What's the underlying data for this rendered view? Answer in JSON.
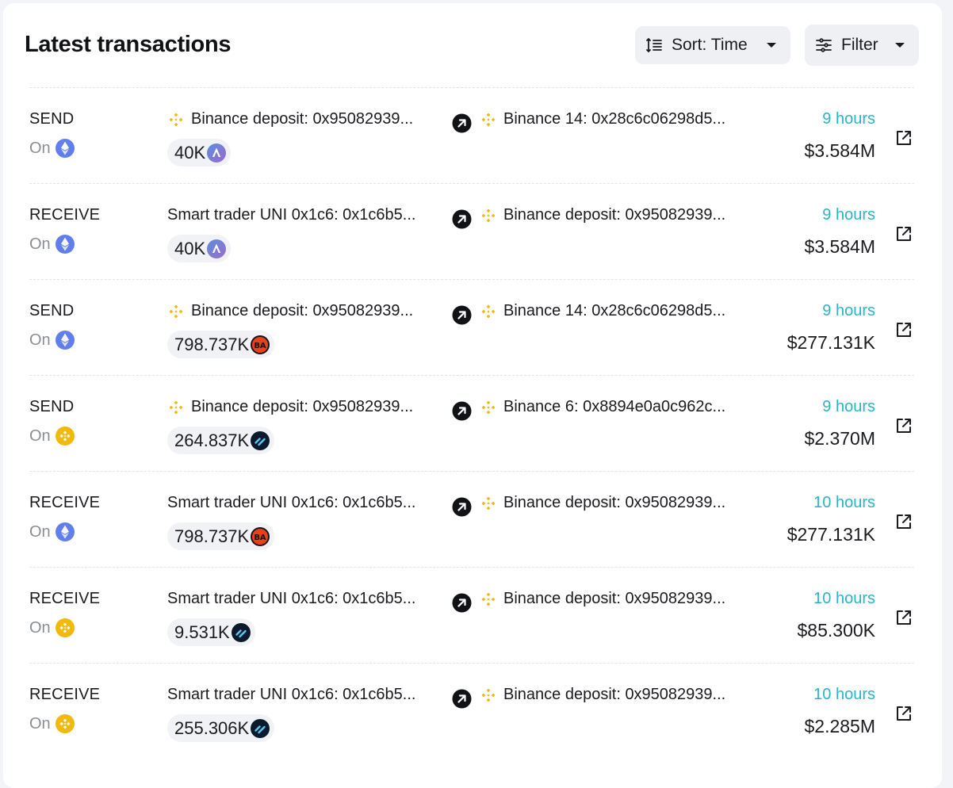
{
  "header": {
    "title": "Latest transactions",
    "sort": {
      "label": "Sort: Time",
      "icon": "sort-icon"
    },
    "filter": {
      "label": "Filter",
      "icon": "filter-icon"
    }
  },
  "colors": {
    "time": "#2ab4c7",
    "binance": "#f0b90b",
    "ethereum": "#627eea"
  },
  "on_label": "On",
  "transactions": [
    {
      "type": "SEND",
      "chain": "ethereum",
      "from": "Binance deposit: 0x95082939...",
      "from_entity": "binance",
      "to": "Binance 14: 0x28c6c06298d5...",
      "to_entity": "binance",
      "amount": "40K",
      "token": "arkham",
      "time": "9 hours",
      "value": "$3.584M"
    },
    {
      "type": "RECEIVE",
      "chain": "ethereum",
      "from": "Smart trader UNI 0x1c6: 0x1c6b5...",
      "from_entity": "none",
      "to": "Binance deposit: 0x95082939...",
      "to_entity": "binance",
      "amount": "40K",
      "token": "arkham",
      "time": "9 hours",
      "value": "$3.584M"
    },
    {
      "type": "SEND",
      "chain": "ethereum",
      "from": "Binance deposit: 0x95082939...",
      "from_entity": "binance",
      "to": "Binance 14: 0x28c6c06298d5...",
      "to_entity": "binance",
      "amount": "798.737K",
      "token": "ba",
      "time": "9 hours",
      "value": "$277.131K"
    },
    {
      "type": "SEND",
      "chain": "bnb",
      "from": "Binance deposit: 0x95082939...",
      "from_entity": "binance",
      "to": "Binance 6: 0x8894e0a0c962c...",
      "to_entity": "binance",
      "amount": "264.837K",
      "token": "swirl",
      "time": "9 hours",
      "value": "$2.370M"
    },
    {
      "type": "RECEIVE",
      "chain": "ethereum",
      "from": "Smart trader UNI 0x1c6: 0x1c6b5...",
      "from_entity": "none",
      "to": "Binance deposit: 0x95082939...",
      "to_entity": "binance",
      "amount": "798.737K",
      "token": "ba",
      "time": "10 hours",
      "value": "$277.131K"
    },
    {
      "type": "RECEIVE",
      "chain": "bnb",
      "from": "Smart trader UNI 0x1c6: 0x1c6b5...",
      "from_entity": "none",
      "to": "Binance deposit: 0x95082939...",
      "to_entity": "binance",
      "amount": "9.531K",
      "token": "swirl",
      "time": "10 hours",
      "value": "$85.300K"
    },
    {
      "type": "RECEIVE",
      "chain": "bnb",
      "from": "Smart trader UNI 0x1c6: 0x1c6b5...",
      "from_entity": "none",
      "to": "Binance deposit: 0x95082939...",
      "to_entity": "binance",
      "amount": "255.306K",
      "token": "swirl",
      "time": "10 hours",
      "value": "$2.285M"
    }
  ]
}
